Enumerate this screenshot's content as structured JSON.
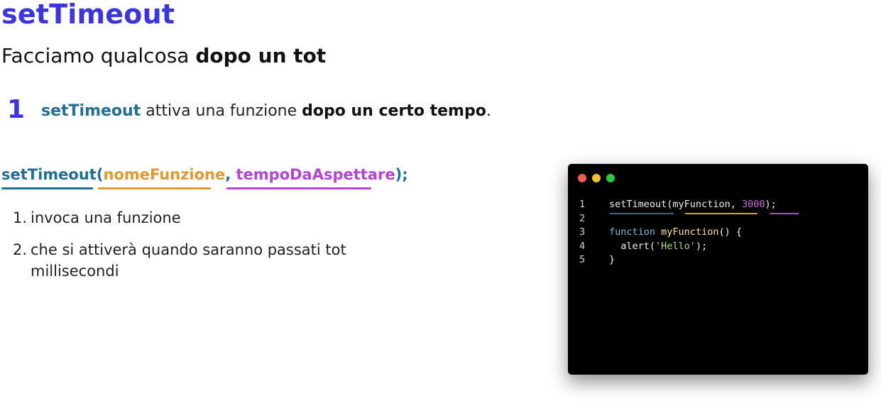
{
  "title": "setTimeout",
  "subtitle": {
    "normal": "Facciamo qualcosa ",
    "bold": "dopo un tot"
  },
  "step": {
    "number": "1",
    "keyword": "setTimeout",
    "middle": " attiva una funzione ",
    "bold": "dopo un certo tempo",
    "end": "."
  },
  "signature": {
    "name": "setTimeout(",
    "param1": "nomeFunzione",
    "comma": ", ",
    "param2": "tempoDaAspettare",
    "end": ");"
  },
  "list": [
    {
      "num": "1.",
      "text": "invoca una funzione"
    },
    {
      "num": "2.",
      "text": "che si attiverà quando saranno passati tot millisecondi"
    }
  ],
  "code": {
    "line_numbers": [
      "1",
      "2",
      "3",
      "4",
      "5"
    ],
    "l1_call": "setTimeout",
    "l1_open": "(",
    "l1_arg1": "myFunction",
    "l1_comma": ", ",
    "l1_arg2": "3000",
    "l1_close": ");",
    "l3_kw": "function",
    "l3_name": "myFunction",
    "l3_rest": "() {",
    "l4_call": "  alert(",
    "l4_str": "'Hello'",
    "l4_close": ");",
    "l5": "}"
  },
  "colors": {
    "title": "#3a35e0",
    "keyword": "#1f6f96",
    "param1": "#e09a2c",
    "param2": "#b443d8"
  }
}
